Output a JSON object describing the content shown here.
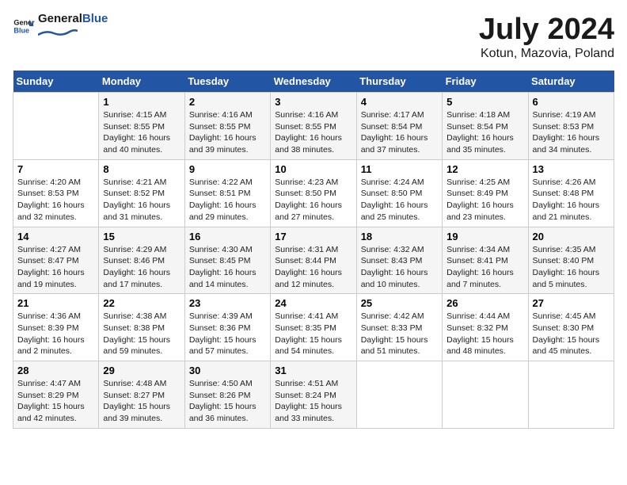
{
  "logo": {
    "text_general": "General",
    "text_blue": "Blue"
  },
  "title": "July 2024",
  "subtitle": "Kotun, Mazovia, Poland",
  "days_header": [
    "Sunday",
    "Monday",
    "Tuesday",
    "Wednesday",
    "Thursday",
    "Friday",
    "Saturday"
  ],
  "weeks": [
    [
      {
        "day": "",
        "info": ""
      },
      {
        "day": "1",
        "info": "Sunrise: 4:15 AM\nSunset: 8:55 PM\nDaylight: 16 hours\nand 40 minutes."
      },
      {
        "day": "2",
        "info": "Sunrise: 4:16 AM\nSunset: 8:55 PM\nDaylight: 16 hours\nand 39 minutes."
      },
      {
        "day": "3",
        "info": "Sunrise: 4:16 AM\nSunset: 8:55 PM\nDaylight: 16 hours\nand 38 minutes."
      },
      {
        "day": "4",
        "info": "Sunrise: 4:17 AM\nSunset: 8:54 PM\nDaylight: 16 hours\nand 37 minutes."
      },
      {
        "day": "5",
        "info": "Sunrise: 4:18 AM\nSunset: 8:54 PM\nDaylight: 16 hours\nand 35 minutes."
      },
      {
        "day": "6",
        "info": "Sunrise: 4:19 AM\nSunset: 8:53 PM\nDaylight: 16 hours\nand 34 minutes."
      }
    ],
    [
      {
        "day": "7",
        "info": "Sunrise: 4:20 AM\nSunset: 8:53 PM\nDaylight: 16 hours\nand 32 minutes."
      },
      {
        "day": "8",
        "info": "Sunrise: 4:21 AM\nSunset: 8:52 PM\nDaylight: 16 hours\nand 31 minutes."
      },
      {
        "day": "9",
        "info": "Sunrise: 4:22 AM\nSunset: 8:51 PM\nDaylight: 16 hours\nand 29 minutes."
      },
      {
        "day": "10",
        "info": "Sunrise: 4:23 AM\nSunset: 8:50 PM\nDaylight: 16 hours\nand 27 minutes."
      },
      {
        "day": "11",
        "info": "Sunrise: 4:24 AM\nSunset: 8:50 PM\nDaylight: 16 hours\nand 25 minutes."
      },
      {
        "day": "12",
        "info": "Sunrise: 4:25 AM\nSunset: 8:49 PM\nDaylight: 16 hours\nand 23 minutes."
      },
      {
        "day": "13",
        "info": "Sunrise: 4:26 AM\nSunset: 8:48 PM\nDaylight: 16 hours\nand 21 minutes."
      }
    ],
    [
      {
        "day": "14",
        "info": "Sunrise: 4:27 AM\nSunset: 8:47 PM\nDaylight: 16 hours\nand 19 minutes."
      },
      {
        "day": "15",
        "info": "Sunrise: 4:29 AM\nSunset: 8:46 PM\nDaylight: 16 hours\nand 17 minutes."
      },
      {
        "day": "16",
        "info": "Sunrise: 4:30 AM\nSunset: 8:45 PM\nDaylight: 16 hours\nand 14 minutes."
      },
      {
        "day": "17",
        "info": "Sunrise: 4:31 AM\nSunset: 8:44 PM\nDaylight: 16 hours\nand 12 minutes."
      },
      {
        "day": "18",
        "info": "Sunrise: 4:32 AM\nSunset: 8:43 PM\nDaylight: 16 hours\nand 10 minutes."
      },
      {
        "day": "19",
        "info": "Sunrise: 4:34 AM\nSunset: 8:41 PM\nDaylight: 16 hours\nand 7 minutes."
      },
      {
        "day": "20",
        "info": "Sunrise: 4:35 AM\nSunset: 8:40 PM\nDaylight: 16 hours\nand 5 minutes."
      }
    ],
    [
      {
        "day": "21",
        "info": "Sunrise: 4:36 AM\nSunset: 8:39 PM\nDaylight: 16 hours\nand 2 minutes."
      },
      {
        "day": "22",
        "info": "Sunrise: 4:38 AM\nSunset: 8:38 PM\nDaylight: 15 hours\nand 59 minutes."
      },
      {
        "day": "23",
        "info": "Sunrise: 4:39 AM\nSunset: 8:36 PM\nDaylight: 15 hours\nand 57 minutes."
      },
      {
        "day": "24",
        "info": "Sunrise: 4:41 AM\nSunset: 8:35 PM\nDaylight: 15 hours\nand 54 minutes."
      },
      {
        "day": "25",
        "info": "Sunrise: 4:42 AM\nSunset: 8:33 PM\nDaylight: 15 hours\nand 51 minutes."
      },
      {
        "day": "26",
        "info": "Sunrise: 4:44 AM\nSunset: 8:32 PM\nDaylight: 15 hours\nand 48 minutes."
      },
      {
        "day": "27",
        "info": "Sunrise: 4:45 AM\nSunset: 8:30 PM\nDaylight: 15 hours\nand 45 minutes."
      }
    ],
    [
      {
        "day": "28",
        "info": "Sunrise: 4:47 AM\nSunset: 8:29 PM\nDaylight: 15 hours\nand 42 minutes."
      },
      {
        "day": "29",
        "info": "Sunrise: 4:48 AM\nSunset: 8:27 PM\nDaylight: 15 hours\nand 39 minutes."
      },
      {
        "day": "30",
        "info": "Sunrise: 4:50 AM\nSunset: 8:26 PM\nDaylight: 15 hours\nand 36 minutes."
      },
      {
        "day": "31",
        "info": "Sunrise: 4:51 AM\nSunset: 8:24 PM\nDaylight: 15 hours\nand 33 minutes."
      },
      {
        "day": "",
        "info": ""
      },
      {
        "day": "",
        "info": ""
      },
      {
        "day": "",
        "info": ""
      }
    ]
  ]
}
